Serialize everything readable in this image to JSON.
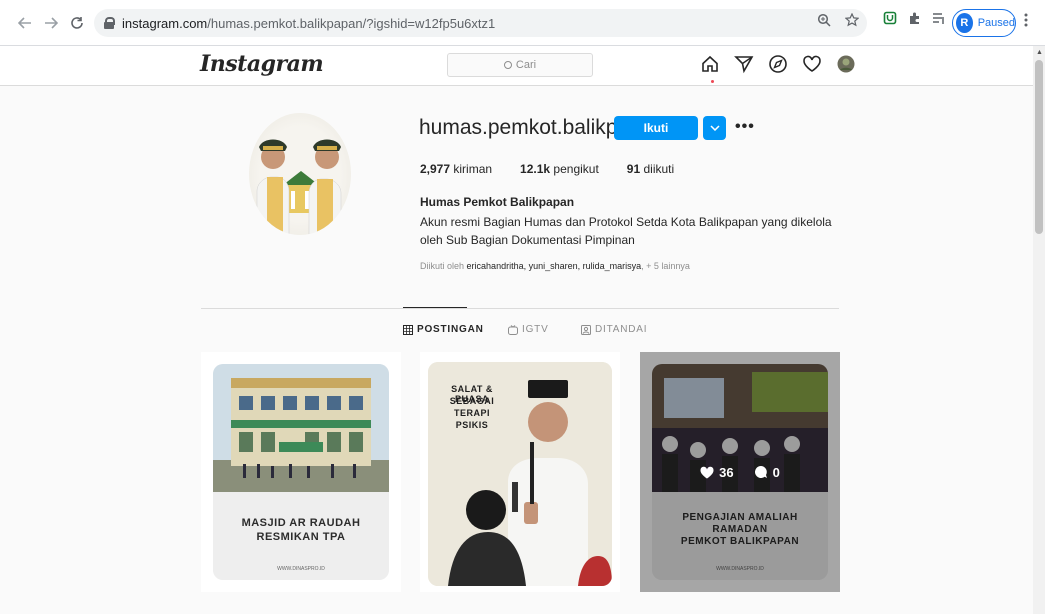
{
  "browser": {
    "url_host": "instagram.com",
    "url_path": "/humas.pemkot.balikpapan/?igshid=w12fp5u6xtz1",
    "profile_initial": "R",
    "profile_status": "Paused"
  },
  "header": {
    "logo": "Instagram",
    "search_placeholder": "Cari"
  },
  "profile": {
    "username": "humas.pemkot.balikpapan",
    "follow_label": "Ikuti",
    "more_label": "•••",
    "stats": [
      {
        "value": "2,977",
        "label": "kiriman"
      },
      {
        "value": "12.1k",
        "label": "pengikut"
      },
      {
        "value": "91",
        "label": "diikuti"
      }
    ],
    "full_name": "Humas Pemkot Balikpapan",
    "bio": "Akun resmi Bagian Humas dan Protokol Setda Kota Balikpapan yang dikelola oleh Sub Bagian Dokumentasi Pimpinan",
    "followed_by_prefix": "Diikuti oleh",
    "followed_by_names": "ericahandritha, yuni_sharen, rulida_marisya",
    "followed_by_suffix": ", + 5 lainnya"
  },
  "tabs": [
    {
      "label": "POSTINGAN",
      "icon": "grid-icon",
      "active": true
    },
    {
      "label": "IGTV",
      "icon": "igtv-icon",
      "active": false
    },
    {
      "label": "DITANDAI",
      "icon": "tagged-icon",
      "active": false
    }
  ],
  "posts": [
    {
      "caption_line1": "MASJID AR RAUDAH",
      "caption_line2": "RESMIKAN TPA",
      "credit": "WWW.DINASPRO.ID"
    },
    {
      "caption_line1": "SALAT & PUASA",
      "caption_line2": "SEBAGAI",
      "caption_line3": "TERAPI",
      "caption_line4": "PSIKIS"
    },
    {
      "caption_line1": "PENGAJIAN AMALIAH",
      "caption_line2": "RAMADAN",
      "caption_line3": "PEMKOT BALIKPAPAN",
      "credit": "WWW.DINASPRO.ID",
      "likes": "36",
      "comments": "0"
    }
  ],
  "colors": {
    "follow_blue": "#0095f6",
    "chrome_blue": "#1a73e8",
    "notify_red": "#ed4956"
  }
}
